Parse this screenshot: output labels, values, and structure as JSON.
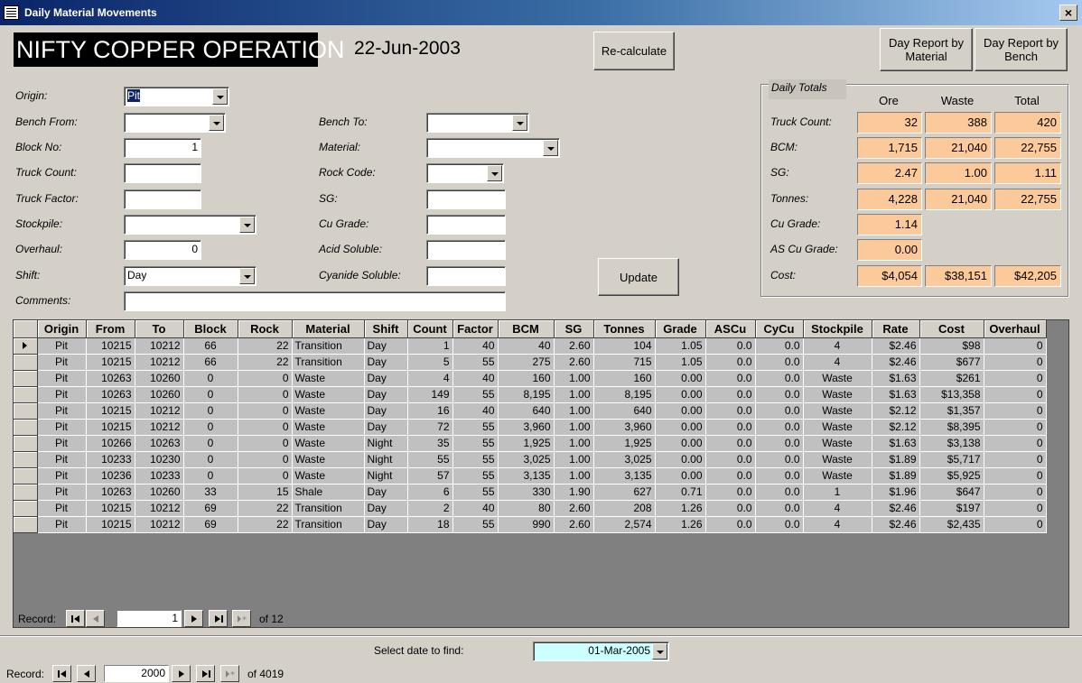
{
  "window": {
    "title": "Daily Material Movements",
    "close_label": "×"
  },
  "header": {
    "company": "NIFTY COPPER OPERATION",
    "date": "22-Jun-2003",
    "recalc_label": "Re-calculate",
    "report_material_label": "Day Report by Material",
    "report_bench_label": "Day Report by Bench"
  },
  "form": {
    "origin": {
      "label": "Origin:",
      "value": "Pit"
    },
    "bench_from": {
      "label": "Bench From:",
      "value": ""
    },
    "block_no": {
      "label": "Block No:",
      "value": "1"
    },
    "truck_count": {
      "label": "Truck Count:",
      "value": ""
    },
    "truck_factor": {
      "label": "Truck Factor:",
      "value": ""
    },
    "stockpile": {
      "label": "Stockpile:",
      "value": ""
    },
    "overhaul": {
      "label": "Overhaul:",
      "value": "0"
    },
    "shift": {
      "label": "Shift:",
      "value": "Day"
    },
    "comments": {
      "label": "Comments:",
      "value": ""
    },
    "bench_to": {
      "label": "Bench To:",
      "value": ""
    },
    "material": {
      "label": "Material:",
      "value": ""
    },
    "rock_code": {
      "label": "Rock Code:",
      "value": ""
    },
    "sg": {
      "label": "SG:",
      "value": ""
    },
    "cu_grade": {
      "label": "Cu Grade:",
      "value": ""
    },
    "acid_soluble": {
      "label": "Acid Soluble:",
      "value": ""
    },
    "cyanide_soluble": {
      "label": "Cyanide Soluble:",
      "value": ""
    },
    "update_label": "Update"
  },
  "totals": {
    "title": "Daily Totals",
    "columns": [
      "Ore",
      "Waste",
      "Total"
    ],
    "rows": [
      {
        "label": "Truck Count:",
        "values": [
          "32",
          "388",
          "420"
        ]
      },
      {
        "label": "BCM:",
        "values": [
          "1,715",
          "21,040",
          "22,755"
        ]
      },
      {
        "label": "SG:",
        "values": [
          "2.47",
          "1.00",
          "1.11"
        ]
      },
      {
        "label": "Tonnes:",
        "values": [
          "4,228",
          "21,040",
          "22,755"
        ]
      },
      {
        "label": "Cu Grade:",
        "values": [
          "1.14"
        ]
      },
      {
        "label": "AS Cu Grade:",
        "values": [
          "0.00"
        ]
      },
      {
        "label": "Cost:",
        "values": [
          "$4,054",
          "$38,151",
          "$42,205"
        ]
      }
    ]
  },
  "table": {
    "columns": [
      "Origin",
      "From",
      "To",
      "Block",
      "Rock",
      "Material",
      "Shift",
      "Count",
      "Factor",
      "BCM",
      "SG",
      "Tonnes",
      "Grade",
      "ASCu",
      "CyCu",
      "Stockpile",
      "Rate",
      "Cost",
      "Overhaul"
    ],
    "rows": [
      [
        "Pit",
        "10215",
        "10212",
        "66",
        "22",
        "Transition",
        "Day",
        "1",
        "40",
        "40",
        "2.60",
        "104",
        "1.05",
        "0.0",
        "0.0",
        "4",
        "$2.46",
        "$98",
        "0"
      ],
      [
        "Pit",
        "10215",
        "10212",
        "66",
        "22",
        "Transition",
        "Day",
        "5",
        "55",
        "275",
        "2.60",
        "715",
        "1.05",
        "0.0",
        "0.0",
        "4",
        "$2.46",
        "$677",
        "0"
      ],
      [
        "Pit",
        "10263",
        "10260",
        "0",
        "0",
        "Waste",
        "Day",
        "4",
        "40",
        "160",
        "1.00",
        "160",
        "0.00",
        "0.0",
        "0.0",
        "Waste",
        "$1.63",
        "$261",
        "0"
      ],
      [
        "Pit",
        "10263",
        "10260",
        "0",
        "0",
        "Waste",
        "Day",
        "149",
        "55",
        "8,195",
        "1.00",
        "8,195",
        "0.00",
        "0.0",
        "0.0",
        "Waste",
        "$1.63",
        "$13,358",
        "0"
      ],
      [
        "Pit",
        "10215",
        "10212",
        "0",
        "0",
        "Waste",
        "Day",
        "16",
        "40",
        "640",
        "1.00",
        "640",
        "0.00",
        "0.0",
        "0.0",
        "Waste",
        "$2.12",
        "$1,357",
        "0"
      ],
      [
        "Pit",
        "10215",
        "10212",
        "0",
        "0",
        "Waste",
        "Day",
        "72",
        "55",
        "3,960",
        "1.00",
        "3,960",
        "0.00",
        "0.0",
        "0.0",
        "Waste",
        "$2.12",
        "$8,395",
        "0"
      ],
      [
        "Pit",
        "10266",
        "10263",
        "0",
        "0",
        "Waste",
        "Night",
        "35",
        "55",
        "1,925",
        "1.00",
        "1,925",
        "0.00",
        "0.0",
        "0.0",
        "Waste",
        "$1.63",
        "$3,138",
        "0"
      ],
      [
        "Pit",
        "10233",
        "10230",
        "0",
        "0",
        "Waste",
        "Night",
        "55",
        "55",
        "3,025",
        "1.00",
        "3,025",
        "0.00",
        "0.0",
        "0.0",
        "Waste",
        "$1.89",
        "$5,717",
        "0"
      ],
      [
        "Pit",
        "10236",
        "10233",
        "0",
        "0",
        "Waste",
        "Night",
        "57",
        "55",
        "3,135",
        "1.00",
        "3,135",
        "0.00",
        "0.0",
        "0.0",
        "Waste",
        "$1.89",
        "$5,925",
        "0"
      ],
      [
        "Pit",
        "10263",
        "10260",
        "33",
        "15",
        "Shale",
        "Day",
        "6",
        "55",
        "330",
        "1.90",
        "627",
        "0.71",
        "0.0",
        "0.0",
        "1",
        "$1.96",
        "$647",
        "0"
      ],
      [
        "Pit",
        "10215",
        "10212",
        "69",
        "22",
        "Transition",
        "Day",
        "2",
        "40",
        "80",
        "2.60",
        "208",
        "1.26",
        "0.0",
        "0.0",
        "4",
        "$2.46",
        "$197",
        "0"
      ],
      [
        "Pit",
        "10215",
        "10212",
        "69",
        "22",
        "Transition",
        "Day",
        "18",
        "55",
        "990",
        "2.60",
        "2,574",
        "1.26",
        "0.0",
        "0.0",
        "4",
        "$2.46",
        "$2,435",
        "0"
      ]
    ]
  },
  "subform_nav": {
    "label": "Record:",
    "current": "1",
    "of_text": "of 12"
  },
  "date_find": {
    "label": "Select date to find:",
    "value": "01-Mar-2005",
    "bg_color": "#ccffff"
  },
  "main_nav": {
    "label": "Record:",
    "current": "2000",
    "of_text": "of 4019"
  },
  "colors": {
    "totals_bg": "#fcc99a",
    "title_bar": "#0a246a",
    "form_bg": "#d4d0c8"
  }
}
